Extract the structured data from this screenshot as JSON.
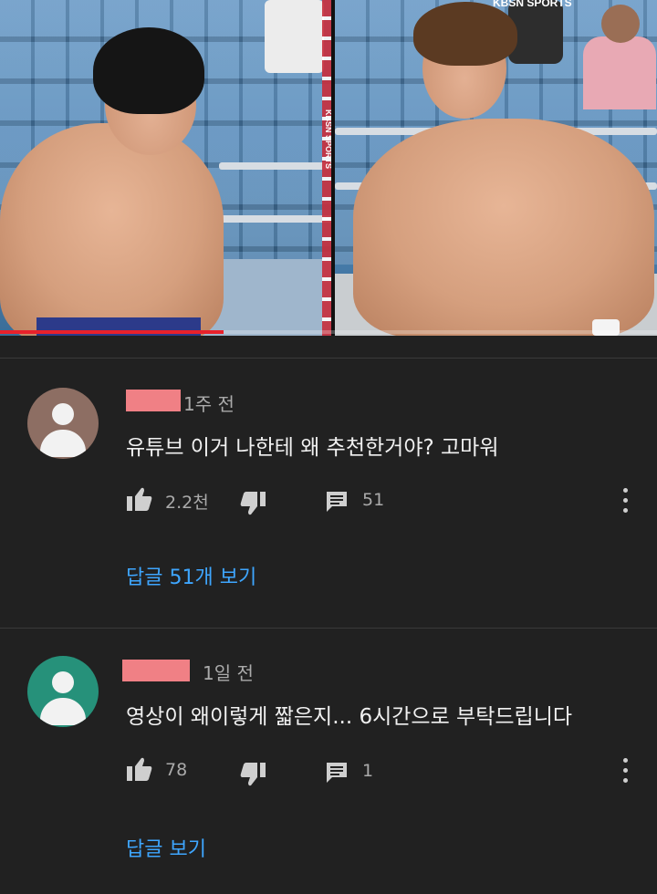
{
  "video": {
    "channel_logo": "KBSN SPORTS",
    "channel_logo_top": "KBSN SPORTS",
    "progress": 0.34,
    "accent_color": "#e8212b"
  },
  "comments": [
    {
      "author_redacted": true,
      "avatar_color": "#8d6e63",
      "time": "1주 전",
      "text": "유튜브 이거 나한테 왜 추천한거야? 고마워",
      "likes": "2.2천",
      "replies_count": "51",
      "view_replies": "답글 51개 보기",
      "icons": [
        "thumb-up-icon",
        "thumb-down-icon",
        "reply-icon",
        "more-vert-icon"
      ]
    },
    {
      "author_redacted": true,
      "avatar_color": "#26917a",
      "time": "1일 전",
      "text": "영상이 왜이렇게 짧은지... 6시간으로 부탁드립니다",
      "likes": "78",
      "replies_count": "1",
      "view_replies": "답글 보기",
      "icons": [
        "thumb-up-icon",
        "thumb-down-icon",
        "reply-icon",
        "more-vert-icon"
      ]
    }
  ],
  "colors": {
    "background": "#212121",
    "link": "#3ea6ff",
    "redaction": "#f08085"
  }
}
